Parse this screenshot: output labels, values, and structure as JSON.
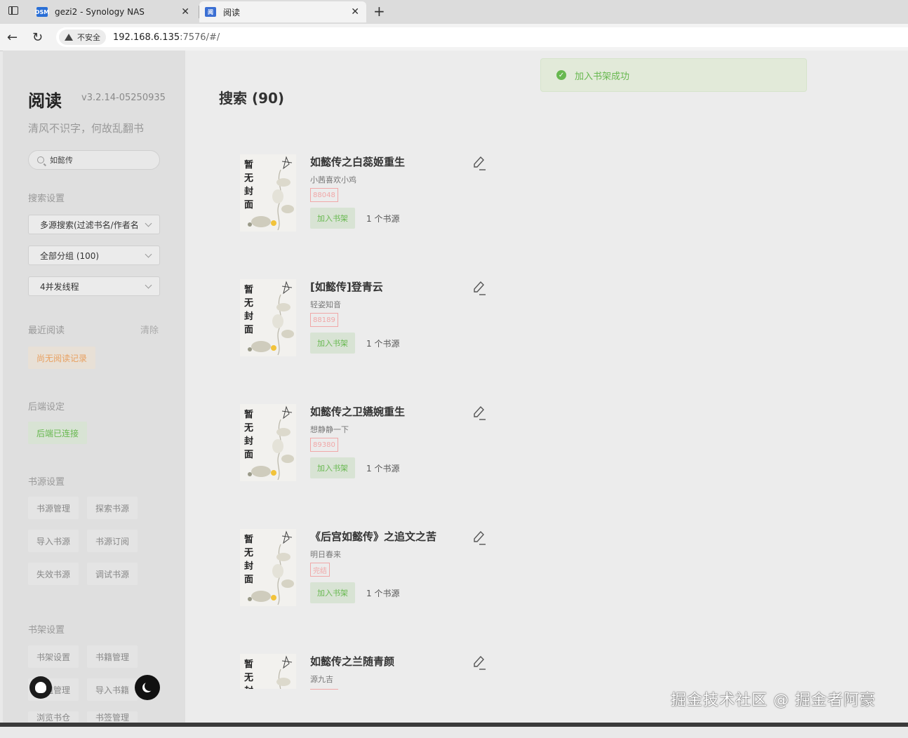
{
  "browser": {
    "tabs": [
      {
        "title": "gezi2 - Synology NAS",
        "favicon": "DSM",
        "active": false
      },
      {
        "title": "阅读",
        "favicon": "阅",
        "active": true
      }
    ],
    "security_label": "不安全",
    "url_host": "192.168.6.135",
    "url_rest": ":7576/#/"
  },
  "sidebar": {
    "title": "阅读",
    "version": "v3.2.14-05250935",
    "subtitle": "清风不识字，何故乱翻书",
    "search_value": "如懿传",
    "search_settings_label": "搜索设置",
    "search_mode": "多源搜索(过滤书名/作者名)",
    "group_select": "全部分组 (100)",
    "thread_select": "4并发线程",
    "recent_label": "最近阅读",
    "clear_label": "清除",
    "no_history": "尚无阅读记录",
    "backend_label": "后端设定",
    "backend_status": "后端已连接",
    "source_label": "书源设置",
    "source_buttons": [
      "书源管理",
      "探索书源",
      "导入书源",
      "书源订阅",
      "失效书源",
      "调试书源"
    ],
    "shelf_label": "书架设置",
    "shelf_buttons": [
      "书架设置",
      "书籍管理",
      "分组管理",
      "导入书籍"
    ],
    "more_buttons": [
      "浏览书仓",
      "书签管理"
    ]
  },
  "main": {
    "title": "搜索 (90)",
    "toast": "加入书架成功",
    "add_label": "加入书架",
    "books": [
      {
        "name": "如懿传之白蕊姬重生",
        "author": "小茜喜欢小鸡",
        "words": "88048",
        "sources": "1 个书源"
      },
      {
        "name": "[如懿传]登青云",
        "author": "轻姿知音",
        "words": "88189",
        "sources": "1 个书源"
      },
      {
        "name": "如懿传之卫嬿婉重生",
        "author": "想静静一下",
        "words": "89380",
        "sources": "1 个书源"
      },
      {
        "name": "《后宫如懿传》之追文之苦",
        "author": "明日春来",
        "words": "完结",
        "sources": "1 个书源"
      },
      {
        "name": "如懿传之兰随青颜",
        "author": "源九吉",
        "words": "",
        "sources": ""
      }
    ],
    "cover_text": [
      "暂",
      "无",
      "封",
      "面"
    ]
  },
  "watermark": "掘金技术社区 @ 掘金者阿豪",
  "colors": {
    "accent_green": "#67b84f",
    "warning_orange": "#e8a060",
    "words_red": "#f0a8a8"
  }
}
